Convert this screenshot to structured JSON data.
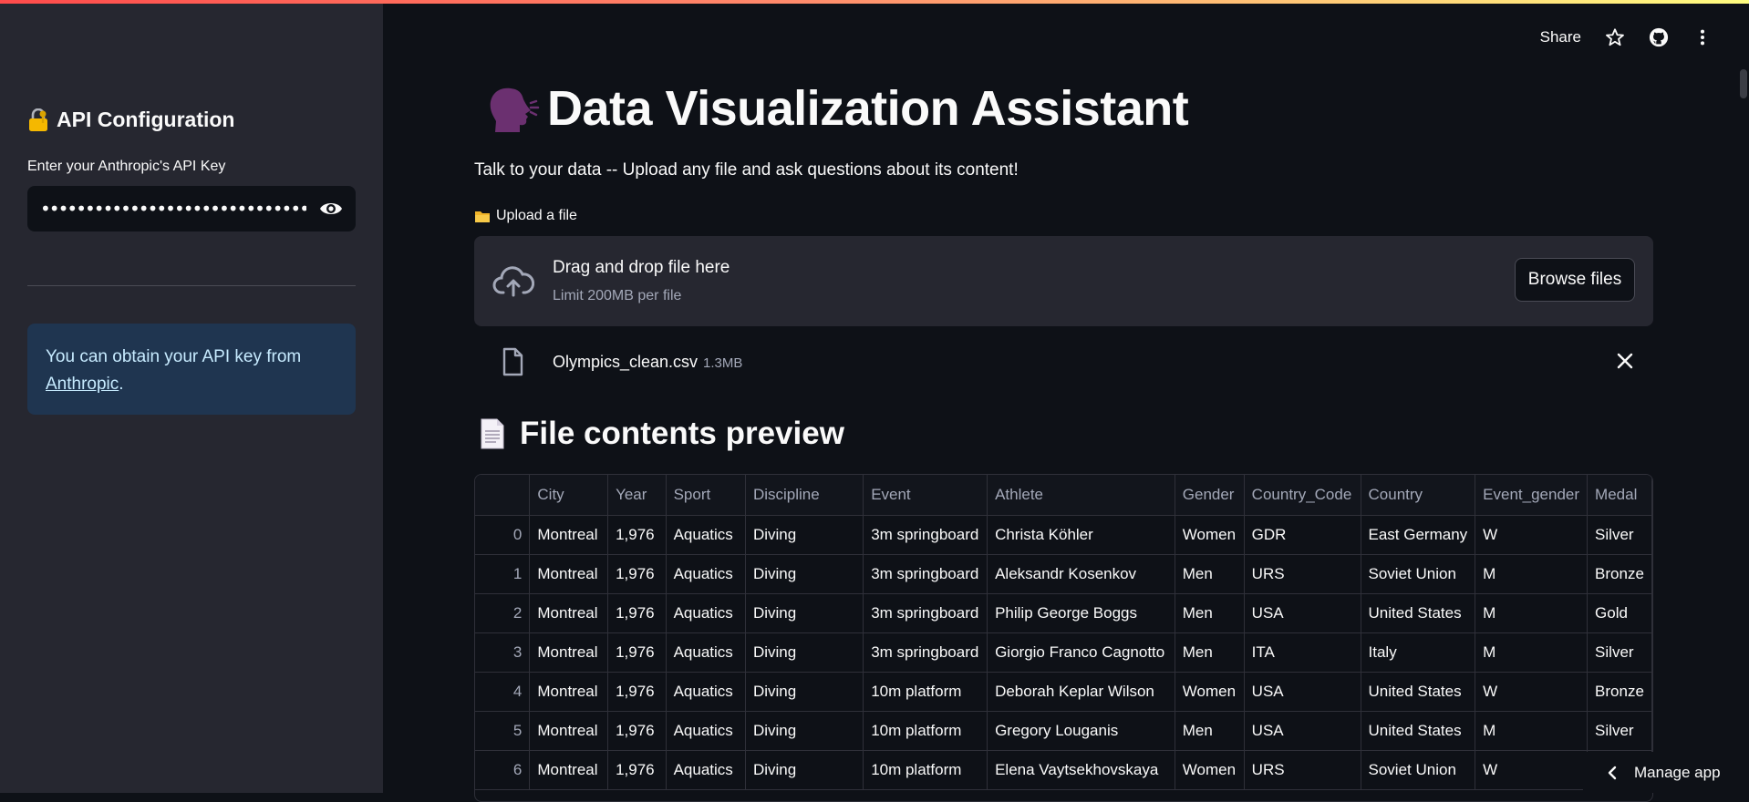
{
  "sidebar": {
    "title": "API Configuration",
    "api_key_label": "Enter your Anthropic's API Key",
    "api_key_value": "••••••••••••••••••••••••••••••••••••••••••",
    "info_text": "You can obtain your API key from ",
    "info_link": "Anthropic",
    "info_suffix": "."
  },
  "header": {
    "share": "Share",
    "icons": [
      "star-icon",
      "github-icon",
      "more-vertical-icon"
    ]
  },
  "main": {
    "title": "Data Visualization Assistant",
    "subtitle": "Talk to your data -- Upload any file and ask questions about its content!",
    "upload_label": "Upload a file",
    "dropzone_title": "Drag and drop file here",
    "dropzone_limit": "Limit 200MB per file",
    "browse_button": "Browse files",
    "file_name": "Olympics_clean.csv",
    "file_size": "1.3MB",
    "preview_title": "File contents preview"
  },
  "table": {
    "columns": [
      "",
      "City",
      "Year",
      "Sport",
      "Discipline",
      "Event",
      "Athlete",
      "Gender",
      "Country_Code",
      "Country",
      "Event_gender",
      "Medal"
    ],
    "rows": [
      [
        "0",
        "Montreal",
        "1,976",
        "Aquatics",
        "Diving",
        "3m springboard",
        "Christa Köhler",
        "Women",
        "GDR",
        "East Germany",
        "W",
        "Silver"
      ],
      [
        "1",
        "Montreal",
        "1,976",
        "Aquatics",
        "Diving",
        "3m springboard",
        "Aleksandr Kosenkov",
        "Men",
        "URS",
        "Soviet Union",
        "M",
        "Bronze"
      ],
      [
        "2",
        "Montreal",
        "1,976",
        "Aquatics",
        "Diving",
        "3m springboard",
        "Philip George Boggs",
        "Men",
        "USA",
        "United States",
        "M",
        "Gold"
      ],
      [
        "3",
        "Montreal",
        "1,976",
        "Aquatics",
        "Diving",
        "3m springboard",
        "Giorgio Franco Cagnotto",
        "Men",
        "ITA",
        "Italy",
        "M",
        "Silver"
      ],
      [
        "4",
        "Montreal",
        "1,976",
        "Aquatics",
        "Diving",
        "10m platform",
        "Deborah Keplar Wilson",
        "Women",
        "USA",
        "United States",
        "W",
        "Bronze"
      ],
      [
        "5",
        "Montreal",
        "1,976",
        "Aquatics",
        "Diving",
        "10m platform",
        "Gregory Louganis",
        "Men",
        "USA",
        "United States",
        "M",
        "Silver"
      ],
      [
        "6",
        "Montreal",
        "1,976",
        "Aquatics",
        "Diving",
        "10m platform",
        "Elena Vaytsekhovskaya",
        "Women",
        "URS",
        "Soviet Union",
        "W",
        ""
      ]
    ]
  },
  "footer": {
    "manage_app": "Manage app"
  },
  "colors": {
    "accent": "#ff4b4b",
    "background": "#0e1117",
    "sidebar": "#262730",
    "info": "#1f3550"
  }
}
